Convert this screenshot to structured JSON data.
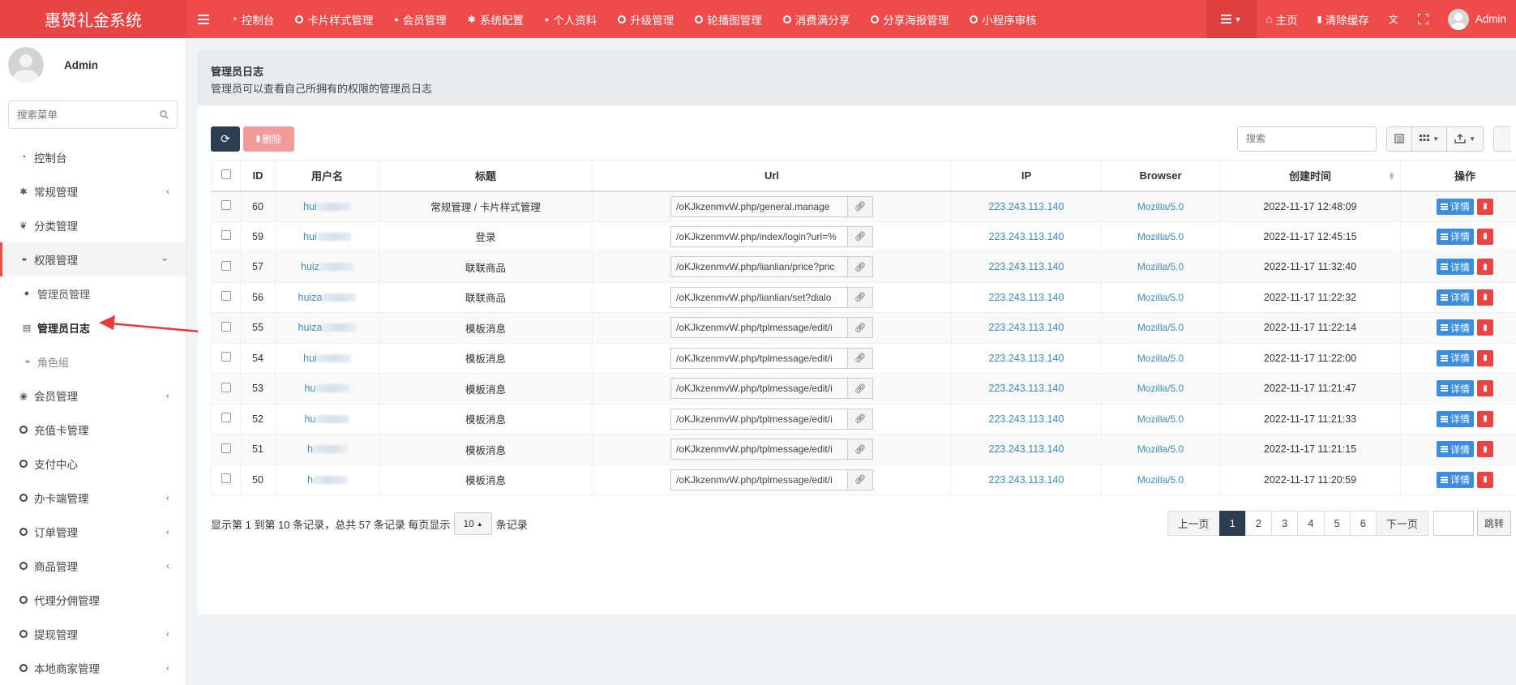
{
  "app": {
    "title": "惠赞礼金系统"
  },
  "topnav": [
    {
      "icon": "dashboard-icon",
      "label": "控制台"
    },
    {
      "icon": "circle-icon",
      "label": "卡片样式管理"
    },
    {
      "icon": "user-icon",
      "label": "会员管理"
    },
    {
      "icon": "gear-icon",
      "label": "系统配置"
    },
    {
      "icon": "user-icon",
      "label": "个人资料"
    },
    {
      "icon": "circle-icon",
      "label": "升级管理"
    },
    {
      "icon": "circle-icon",
      "label": "轮播图管理"
    },
    {
      "icon": "circle-icon",
      "label": "消费满分享"
    },
    {
      "icon": "circle-icon",
      "label": "分享海报管理"
    },
    {
      "icon": "circle-icon",
      "label": "小程序审核"
    }
  ],
  "topright": {
    "home": "主页",
    "clear_cache": "清除缓存",
    "user": "Admin"
  },
  "sidebar": {
    "user": "Admin",
    "search_placeholder": "搜索菜单",
    "items": [
      {
        "label": "控制台",
        "type": "top"
      },
      {
        "label": "常规管理",
        "type": "top"
      },
      {
        "label": "分类管理",
        "type": "top"
      },
      {
        "label": "权限管理",
        "type": "open"
      },
      {
        "label": "管理员管理",
        "type": "sub"
      },
      {
        "label": "管理员日志",
        "type": "active"
      },
      {
        "label": "角色组",
        "type": "sub"
      },
      {
        "label": "会员管理",
        "type": "top"
      },
      {
        "label": "充值卡管理",
        "type": "top"
      },
      {
        "label": "支付中心",
        "type": "top"
      },
      {
        "label": "办卡端管理",
        "type": "top"
      },
      {
        "label": "订单管理",
        "type": "top"
      },
      {
        "label": "商品管理",
        "type": "top"
      },
      {
        "label": "代理分佣管理",
        "type": "top"
      },
      {
        "label": "提现管理",
        "type": "top"
      },
      {
        "label": "本地商家管理",
        "type": "top"
      }
    ]
  },
  "header": {
    "title": "管理员日志",
    "desc": "管理员可以查看自己所拥有的权限的管理员日志"
  },
  "toolbar": {
    "delete_label": "删除",
    "search_placeholder": "搜索"
  },
  "table": {
    "columns": [
      "ID",
      "用户名",
      "标题",
      "Url",
      "IP",
      "Browser",
      "创建时间",
      "操作"
    ],
    "rows": [
      {
        "id": "60",
        "user": "hui",
        "title": "常规管理 / 卡片样式管理",
        "url": "/oKJkzenmvW.php/general.manage",
        "ip": "223.243.113.140",
        "browser": "Mozilla/5.0",
        "time": "2022-11-17 12:48:09"
      },
      {
        "id": "59",
        "user": "hui",
        "title": "登录",
        "url": "/oKJkzenmvW.php/index/login?url=%",
        "ip": "223.243.113.140",
        "browser": "Mozilla/5.0",
        "time": "2022-11-17 12:45:15"
      },
      {
        "id": "57",
        "user": "huiz",
        "title": "联联商品",
        "url": "/oKJkzenmvW.php/lianlian/price?pric",
        "ip": "223.243.113.140",
        "browser": "Mozilla/5.0",
        "time": "2022-11-17 11:32:40"
      },
      {
        "id": "56",
        "user": "huiza",
        "title": "联联商品",
        "url": "/oKJkzenmvW.php/lianlian/set?dialo",
        "ip": "223.243.113.140",
        "browser": "Mozilla/5.0",
        "time": "2022-11-17 11:22:32"
      },
      {
        "id": "55",
        "user": "huiza",
        "title": "模板消息",
        "url": "/oKJkzenmvW.php/tplmessage/edit/i",
        "ip": "223.243.113.140",
        "browser": "Mozilla/5.0",
        "time": "2022-11-17 11:22:14"
      },
      {
        "id": "54",
        "user": "hui",
        "title": "模板消息",
        "url": "/oKJkzenmvW.php/tplmessage/edit/i",
        "ip": "223.243.113.140",
        "browser": "Mozilla/5.0",
        "time": "2022-11-17 11:22:00"
      },
      {
        "id": "53",
        "user": "hu",
        "title": "模板消息",
        "url": "/oKJkzenmvW.php/tplmessage/edit/i",
        "ip": "223.243.113.140",
        "browser": "Mozilla/5.0",
        "time": "2022-11-17 11:21:47"
      },
      {
        "id": "52",
        "user": "hu",
        "title": "模板消息",
        "url": "/oKJkzenmvW.php/tplmessage/edit/i",
        "ip": "223.243.113.140",
        "browser": "Mozilla/5.0",
        "time": "2022-11-17 11:21:33"
      },
      {
        "id": "51",
        "user": "h",
        "title": "模板消息",
        "url": "/oKJkzenmvW.php/tplmessage/edit/i",
        "ip": "223.243.113.140",
        "browser": "Mozilla/5.0",
        "time": "2022-11-17 11:21:15"
      },
      {
        "id": "50",
        "user": "h",
        "title": "模板消息",
        "url": "/oKJkzenmvW.php/tplmessage/edit/i",
        "ip": "223.243.113.140",
        "browser": "Mozilla/5.0",
        "time": "2022-11-17 11:20:59"
      }
    ],
    "detail_label": "详情"
  },
  "pagination": {
    "info_prefix": "显示第 1 到第 10 条记录，总共 57 条记录 每页显示",
    "page_size": "10",
    "info_suffix": "条记录",
    "prev": "上一页",
    "pages": [
      "1",
      "2",
      "3",
      "4",
      "5",
      "6"
    ],
    "next": "下一页",
    "jump": "跳转"
  },
  "colors": {
    "brand": "#f04b4b",
    "dark": "#2c3e50",
    "link": "#3c8dbc",
    "detail": "#3c8dde",
    "danger": "#e84444"
  }
}
